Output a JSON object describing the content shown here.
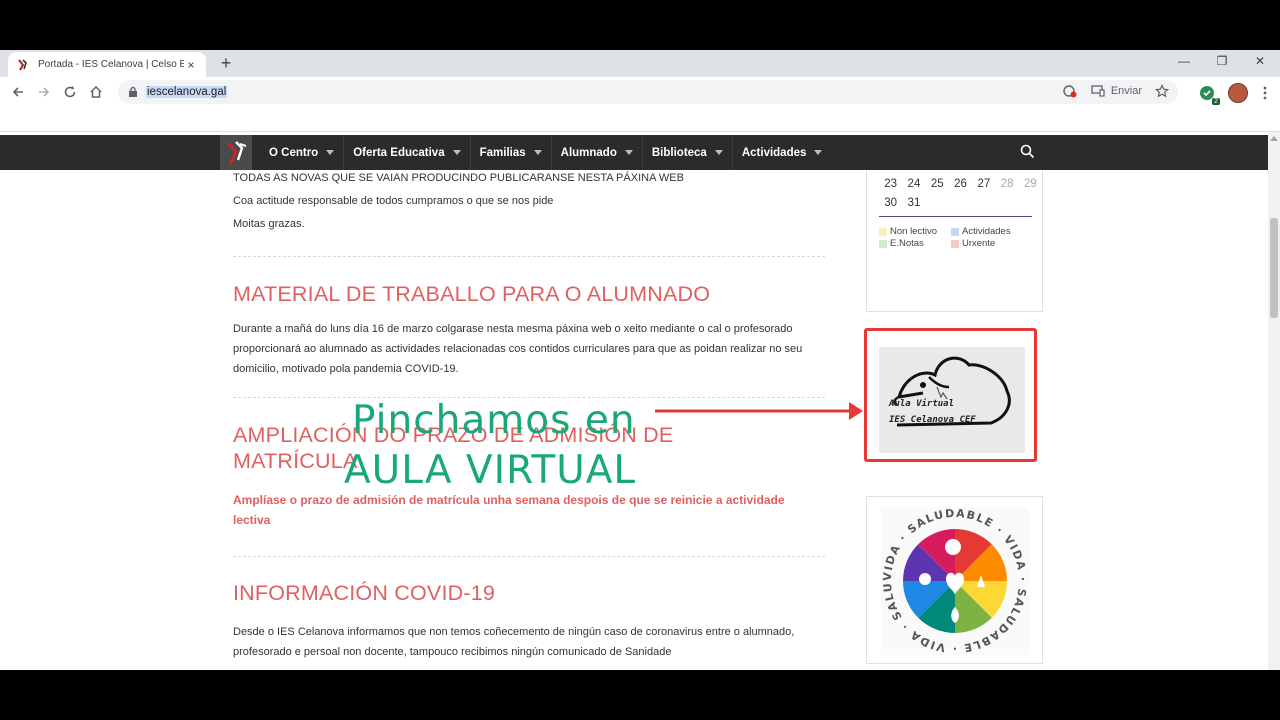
{
  "browser": {
    "tab_title": "Portada - IES Celanova | Celso En",
    "tab_close": "×",
    "new_tab": "+",
    "url": "iescelanova.gal",
    "send_label": "Enviar",
    "extension_badge": "2",
    "window_min": "—",
    "window_max": "❐",
    "window_close": "✕"
  },
  "nav": {
    "items": [
      {
        "label": "O Centro"
      },
      {
        "label": "Oferta Educativa"
      },
      {
        "label": "Familias"
      },
      {
        "label": "Alumnado"
      },
      {
        "label": "Biblioteca"
      },
      {
        "label": "Actividades"
      }
    ]
  },
  "content": {
    "intro": [
      "TODAS AS NOVAS QUE SE VAIAN PRODUCINDO PUBLICARANSE NESTA PÁXINA WEB",
      "Coa actitude responsable de todos cumpramos o que se nos pide",
      "Moitas grazas."
    ],
    "posts": [
      {
        "title": "MATERIAL DE TRABALLO PARA O ALUMNADO",
        "body": "Durante a mañá do luns día 16 de marzo colgarase nesta mesma páxina web o xeito mediante o cal o profesorado proporcionará ao alumnado as actividades relacionadas cos contidos curriculares para que as poidan realizar no seu domicilio, motivado pola pandemia COVID-19."
      },
      {
        "title": "AMPLIACIÓN DO PRAZO DE ADMISIÓN DE MATRÍCULA",
        "body": "Amplíase o prazo de admisión de matrícula unha semana despois de que se reinicie a actividade lectiva"
      },
      {
        "title": "INFORMACIÓN COVID-19",
        "body": "Desde o IES Celanova informamos que non temos coñecemento de ningún caso de coronavirus entre o alumnado, profesorado e persoal non docente, tampouco recibimos ningún comunicado de Sanidade"
      }
    ]
  },
  "calendar": {
    "row1": [
      {
        "d": "23",
        "gray": false
      },
      {
        "d": "24",
        "gray": false
      },
      {
        "d": "25",
        "gray": false
      },
      {
        "d": "26",
        "gray": false
      },
      {
        "d": "27",
        "gray": false
      },
      {
        "d": "28",
        "gray": true
      },
      {
        "d": "29",
        "gray": true
      }
    ],
    "row2": [
      {
        "d": "30",
        "gray": false
      },
      {
        "d": "31",
        "gray": false
      }
    ],
    "legend": {
      "non_lectivo": "Non lectivo",
      "actividades": "Actividades",
      "enotas": "E.Notas",
      "urxente": "Urxente"
    },
    "colors": {
      "non_lectivo": "#f6f3c0",
      "actividades": "#c9d3f2",
      "enotas": "#cdebcf",
      "urxente": "#f3c9c9"
    }
  },
  "sidebar": {
    "aula_line1": "Aula Virtual",
    "aula_line2": "IES Celanova CEF",
    "vida_text": "VIDA · SALUDABLE · VIDA · SALUDABLE · VIDA · SALUDABLE ·"
  },
  "overlay": {
    "line1": "Pinchamos en",
    "line2": "AULA VIRTUAL",
    "accent": "#1aa87a",
    "highlight": "#e53935"
  }
}
